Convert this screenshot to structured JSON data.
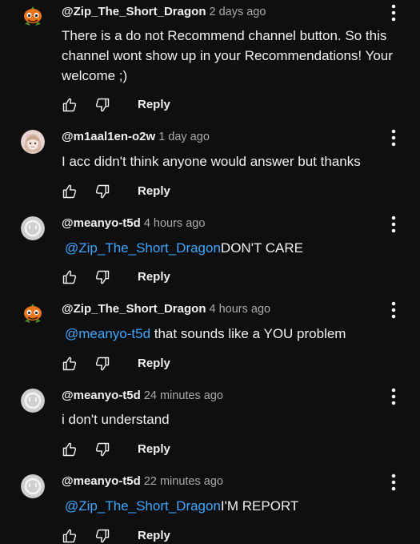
{
  "comments": [
    {
      "author": "@Zip_The_Short_Dragon",
      "time": "2 days ago",
      "avatar": "pumpkin-avatar",
      "mention": "",
      "text": "There is a do not Recommend channel button. So this channel wont show up in your Recommendations! Your welcome ;)",
      "reply_label": "Reply"
    },
    {
      "author": "@m1aal1en-o2w",
      "time": "1 day ago",
      "avatar": "anime-avatar",
      "mention": "",
      "text": "I acc didn't think anyone would answer but thanks",
      "reply_label": "Reply"
    },
    {
      "author": "@meanyo-t5d",
      "time": "4 hours ago",
      "avatar": "face-avatar",
      "mention": "@Zip_The_Short_Dragon",
      "text": "DON'T CARE",
      "reply_label": "Reply"
    },
    {
      "author": "@Zip_The_Short_Dragon",
      "time": "4 hours ago",
      "avatar": "pumpkin-avatar",
      "mention": "@meanyo-t5d",
      "text": " that sounds like a YOU problem",
      "reply_label": "Reply"
    },
    {
      "author": "@meanyo-t5d",
      "time": "24 minutes ago",
      "avatar": "face-avatar",
      "mention": "",
      "text": "i don't understand",
      "reply_label": "Reply"
    },
    {
      "author": "@meanyo-t5d",
      "time": "22 minutes ago",
      "avatar": "face-avatar",
      "mention": "@Zip_The_Short_Dragon",
      "text": "I'M REPORT",
      "reply_label": "Reply"
    }
  ],
  "icons": {
    "like": "thumbs-up-icon",
    "dislike": "thumbs-down-icon",
    "more": "more-vert-icon"
  },
  "colors": {
    "background": "#0f0f0f",
    "text": "#f1f1f1",
    "secondary_text": "#aaaaaa",
    "mention": "#3ea6ff"
  }
}
